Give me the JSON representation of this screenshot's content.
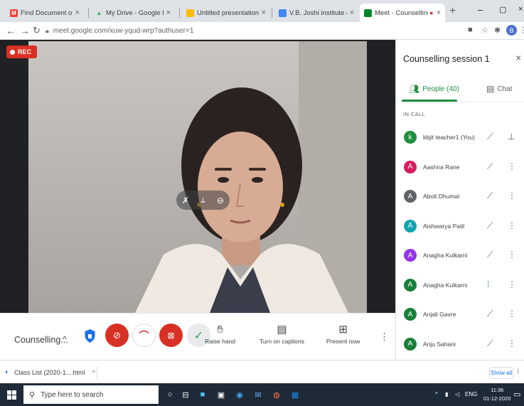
{
  "browser": {
    "tabs": [
      {
        "title": "Find Document of Profile - su",
        "fav_color": "#ea4335",
        "fav_letter": "M"
      },
      {
        "title": "My Drive - Google Drive",
        "fav_color": "#34a853",
        "fav_letter": "▲"
      },
      {
        "title": "Untitled presentation - Googl",
        "fav_color": "#fbbc04",
        "fav_letter": ""
      },
      {
        "title": "V.B. Joshi institute of Informat",
        "fav_color": "#4285f4",
        "fav_letter": ""
      },
      {
        "title": "Meet - Counselling sessi",
        "fav_color": "#00832d",
        "fav_letter": ""
      }
    ],
    "url": "meet.google.com/xuw-yqud-wrp?authuser=1",
    "profile_initial": "B"
  },
  "meeting": {
    "rec_label": "REC",
    "name": "Counselling...",
    "controls": {
      "raise_hand": "Raise hand",
      "captions": "Turn on captions",
      "present": "Present now"
    }
  },
  "panel": {
    "title": "Counselling session 1",
    "people_tab": "People (40)",
    "chat_tab": "Chat",
    "section_label": "IN CALL",
    "people": [
      {
        "name": "kbjit teacher1 (You)",
        "initial": "k",
        "color": "#1e8e3e",
        "mic": "muted",
        "action": "pin"
      },
      {
        "name": "Aashna Rane",
        "initial": "A",
        "color": "#d81b60",
        "mic": "muted",
        "action": "more"
      },
      {
        "name": "Abolt Dhumal",
        "initial": "A",
        "color": "#5f6368",
        "mic": "muted",
        "action": "more"
      },
      {
        "name": "Aishwarya Patil",
        "initial": "A",
        "color": "#12a4af",
        "mic": "muted",
        "action": "more"
      },
      {
        "name": "Anagha Kulkarni",
        "initial": "A",
        "color": "#9334e6",
        "mic": "muted",
        "action": "more"
      },
      {
        "name": "Anagha Kulkarni",
        "initial": "A",
        "color": "#188038",
        "mic": "speaking",
        "action": "more"
      },
      {
        "name": "Anjali Gavre",
        "initial": "A",
        "color": "#188038",
        "mic": "muted",
        "action": "more"
      },
      {
        "name": "Anju Sahani",
        "initial": "A",
        "color": "#188038",
        "mic": "muted",
        "action": "more"
      }
    ]
  },
  "downloads": {
    "file": "Class List (2020-1....html",
    "show_all": "Show all"
  },
  "taskbar": {
    "search_placeholder": "Type here to search",
    "lang": "ENG",
    "time": "11:36",
    "date": "01-12-2020"
  }
}
